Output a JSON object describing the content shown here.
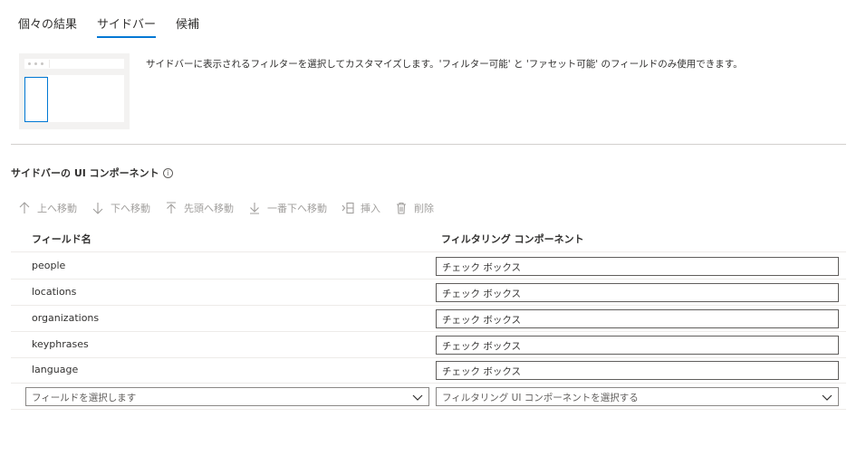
{
  "tabs": [
    {
      "label": "個々の結果",
      "active": false
    },
    {
      "label": "サイドバー",
      "active": true
    },
    {
      "label": "候補",
      "active": false
    }
  ],
  "description": "サイドバーに表示されるフィルターを選択してカスタマイズします。'フィルター可能' と 'ファセット可能' のフィールドのみ使用できます。",
  "section_title": "サイドバーの UI コンポーネント",
  "info_glyph": "i",
  "toolbar": {
    "move_up": "上へ移動",
    "move_down": "下へ移動",
    "move_top": "先頭へ移動",
    "move_bottom": "一番下へ移動",
    "insert": "挿入",
    "delete": "削除"
  },
  "table": {
    "col_field": "フィールド名",
    "col_component": "フィルタリング コンポーネント",
    "rows": [
      {
        "field": "people",
        "component": "チェック ボックス"
      },
      {
        "field": "locations",
        "component": "チェック ボックス"
      },
      {
        "field": "organizations",
        "component": "チェック ボックス"
      },
      {
        "field": "keyphrases",
        "component": "チェック ボックス"
      },
      {
        "field": "language",
        "component": "チェック ボックス"
      }
    ],
    "field_select_placeholder": "フィールドを選択します",
    "component_select_placeholder": "フィルタリング UI コンポーネントを選択する"
  },
  "colors": {
    "accent": "#0078d4",
    "disabled": "#a19f9d",
    "border": "#605e5c"
  }
}
